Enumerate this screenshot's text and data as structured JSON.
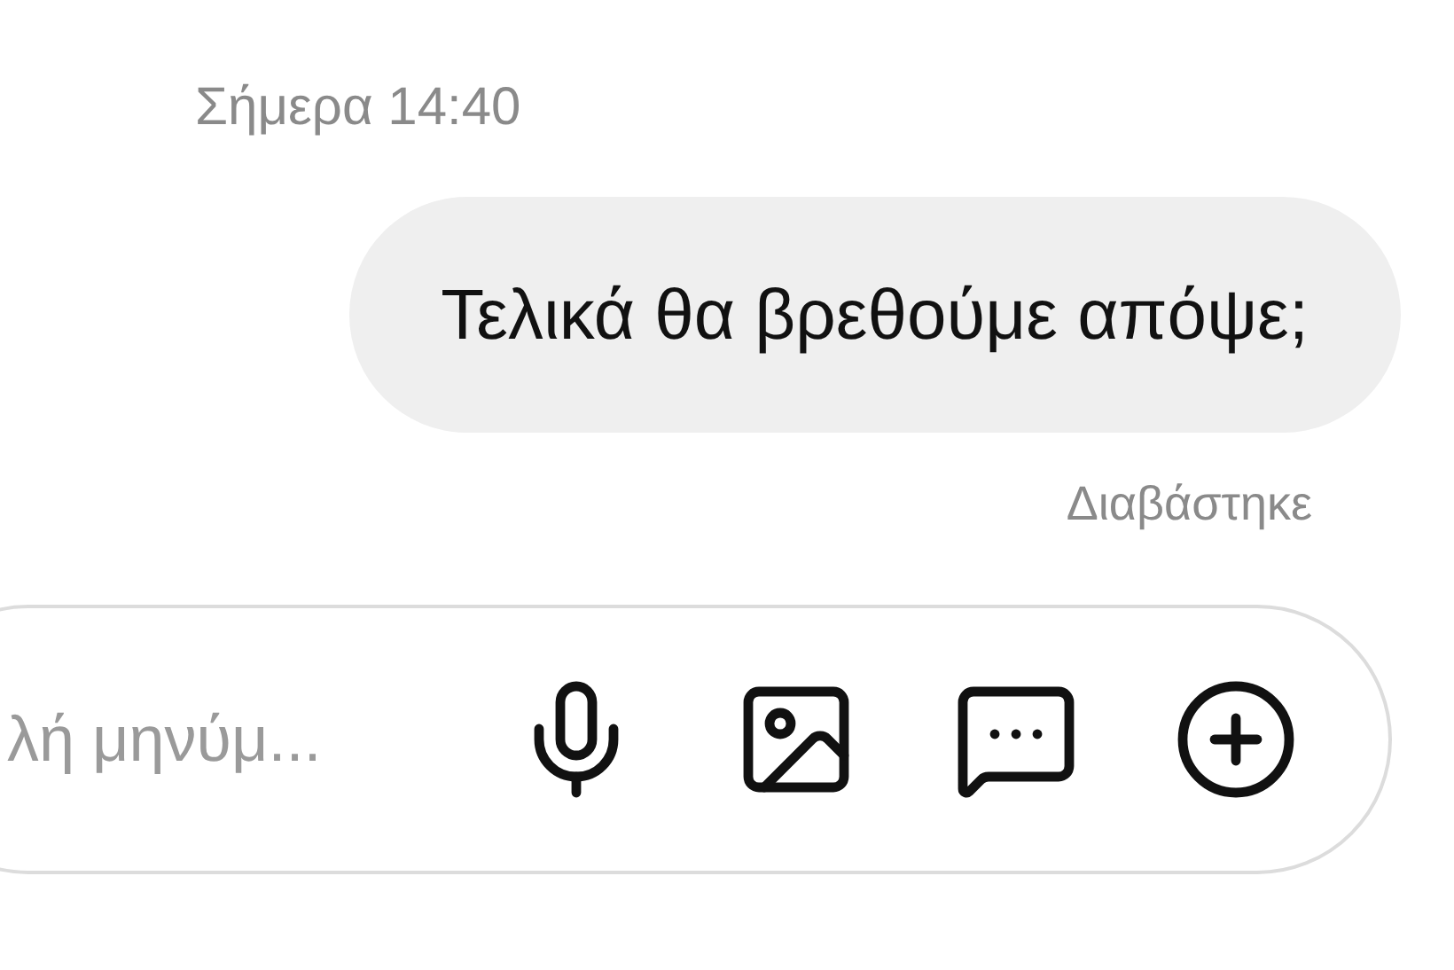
{
  "timestamp": "Σήμερα 14:40",
  "message": {
    "text": "Τελικά θα βρεθούμε απόψε;",
    "status": "Διαβάστηκε"
  },
  "composer": {
    "placeholder": "λή μηνύμ..."
  }
}
